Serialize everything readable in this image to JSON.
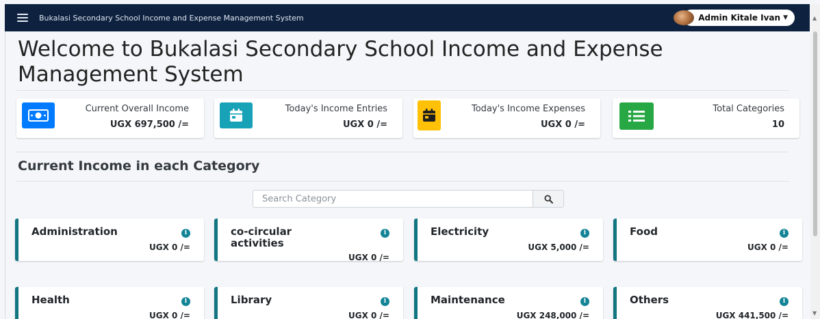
{
  "navbar": {
    "app_title": "Bukalasi Secondary School Income and Expense Management System",
    "user_name": "Admin Kitale Ivan",
    "icons": {
      "menu": "hamburger-icon",
      "dropdown": "caret-down-icon"
    }
  },
  "page": {
    "title": "Welcome to Bukalasi Secondary School Income and Expense Management System"
  },
  "info_boxes": [
    {
      "label": "Current Overall Income",
      "value": "UGX 697,500 /=",
      "icon": "money-icon",
      "color": "#007bff"
    },
    {
      "label": "Today's Income Entries",
      "value": "UGX 0 /=",
      "icon": "calendar-icon",
      "color": "#17a2b8"
    },
    {
      "label": "Today's Income Expenses",
      "value": "UGX 0 /=",
      "icon": "calendar-icon",
      "color": "#ffc107"
    },
    {
      "label": "Total Categories",
      "value": "10",
      "icon": "list-icon",
      "color": "#28a745"
    }
  ],
  "categories_section": {
    "title": "Current Income in each Category",
    "search_placeholder": "Search Category",
    "search_icon": "search-icon"
  },
  "categories": [
    {
      "name": "Administration",
      "amount": "UGX 0 /="
    },
    {
      "name": "co-circular activities",
      "amount": "UGX 0 /="
    },
    {
      "name": "Electricity",
      "amount": "UGX 5,000 /="
    },
    {
      "name": "Food",
      "amount": "UGX 0 /="
    },
    {
      "name": "Health",
      "amount": "UGX 0 /="
    },
    {
      "name": "Library",
      "amount": "UGX 0 /="
    },
    {
      "name": "Maintenance",
      "amount": "UGX 248,000 /="
    },
    {
      "name": "Others",
      "amount": "UGX 441,500 /="
    }
  ],
  "colors": {
    "navbar_bg": "#0e2240",
    "card_accent": "#127582",
    "info_icon": "#138496"
  }
}
